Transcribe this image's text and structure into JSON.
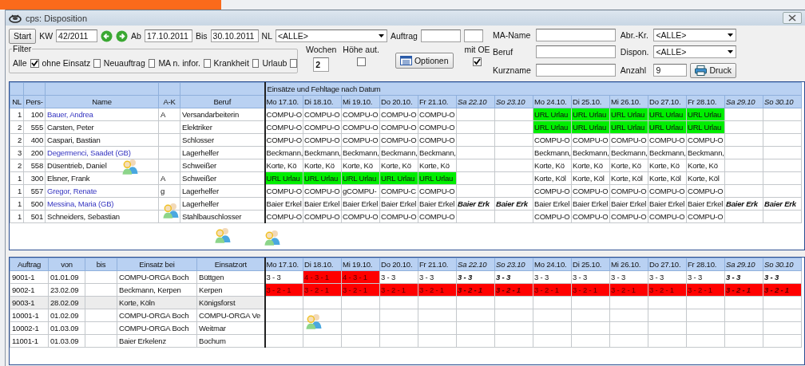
{
  "window": {
    "title": "cps: Disposition"
  },
  "toolbar": {
    "start": "Start",
    "kw_label": "KW",
    "kw": "42/2011",
    "ab_label": "Ab",
    "ab": "17.10.2011",
    "bis_label": "Bis",
    "bis": "30.10.2011",
    "nl_label": "NL",
    "nl": "<ALLE>",
    "auftrag_label": "Auftrag",
    "wochen_label": "Wochen",
    "wochen": "2",
    "hoehe_label": "Höhe aut.",
    "hoehe_checked": false,
    "optionen": "Optionen",
    "mit_oe_label": "mit OE",
    "mit_oe_checked": true,
    "ma_name_label": "MA-Name",
    "abr_label": "Abr.-Kr.",
    "abr": "<ALLE>",
    "beruf_label": "Beruf",
    "dispon_label": "Dispon.",
    "dispon": "<ALLE>",
    "kurzname_label": "Kurzname",
    "anzahl_label": "Anzahl",
    "anzahl": "9",
    "druck": "Druck"
  },
  "filter": {
    "title": "Filter",
    "items": [
      {
        "label": "Alle",
        "checked": true
      },
      {
        "label": "ohne Einsatz",
        "checked": false
      },
      {
        "label": "Neuauftrag",
        "checked": false
      },
      {
        "label": "MA n. infor.",
        "checked": false
      },
      {
        "label": "Krankheit",
        "checked": false
      },
      {
        "label": "Urlaub",
        "checked": false
      }
    ]
  },
  "schedule": {
    "group_title": "Einsätze und Fehltage nach Datum",
    "columns": [
      "NL",
      "Pers-",
      "Name",
      "A-K",
      "Beruf"
    ],
    "days": [
      {
        "label": "Mo 17.10.",
        "weekend": false
      },
      {
        "label": "Di 18.10.",
        "weekend": false
      },
      {
        "label": "Mi 19.10.",
        "weekend": false
      },
      {
        "label": "Do 20.10.",
        "weekend": false
      },
      {
        "label": "Fr 21.10.",
        "weekend": false
      },
      {
        "label": "Sa 22.10",
        "weekend": true
      },
      {
        "label": "So 23.10",
        "weekend": true
      },
      {
        "label": "Mo 24.10.",
        "weekend": false
      },
      {
        "label": "Di 25.10.",
        "weekend": false
      },
      {
        "label": "Mi 26.10.",
        "weekend": false
      },
      {
        "label": "Do 27.10.",
        "weekend": false
      },
      {
        "label": "Fr 28.10.",
        "weekend": false
      },
      {
        "label": "Sa 29.10",
        "weekend": true
      },
      {
        "label": "So 30.10",
        "weekend": true
      }
    ],
    "rows": [
      {
        "nl": "1",
        "pers": "100",
        "name": "Bauer, Andrea",
        "linked": true,
        "ak": "A",
        "beruf": "Versandarbeiterin",
        "days": [
          {
            "kind": "text",
            "text": "COMPU-O"
          },
          {
            "kind": "text",
            "text": "COMPU-O"
          },
          {
            "kind": "text",
            "text": "COMPU-O"
          },
          {
            "kind": "text",
            "text": "COMPU-O"
          },
          {
            "kind": "text",
            "text": "COMPU-O"
          },
          {
            "kind": "blank"
          },
          {
            "kind": "blank"
          },
          {
            "kind": "text",
            "text": "URL Urlau",
            "color": "#00ee00"
          },
          {
            "kind": "text",
            "text": "URL Urlau",
            "color": "#00ee00"
          },
          {
            "kind": "text",
            "text": "URL Urlau",
            "color": "#00ee00"
          },
          {
            "kind": "text",
            "text": "URL Urlau",
            "color": "#00ee00"
          },
          {
            "kind": "text",
            "text": "URL Urlau",
            "color": "#00ee00"
          },
          {
            "kind": "blank"
          },
          {
            "kind": "blank"
          }
        ]
      },
      {
        "nl": "2",
        "pers": "555",
        "name": "Carsten, Peter",
        "linked": false,
        "beruf": "Elektriker",
        "days": [
          {
            "kind": "text",
            "text": "COMPU-O"
          },
          {
            "kind": "text",
            "text": "COMPU-O"
          },
          {
            "kind": "text",
            "text": "COMPU-O"
          },
          {
            "kind": "text",
            "text": "COMPU-O"
          },
          {
            "kind": "text",
            "text": "COMPU-O"
          },
          {
            "kind": "blank"
          },
          {
            "kind": "blank"
          },
          {
            "kind": "text",
            "text": "URL Urlau",
            "color": "#00ee00"
          },
          {
            "kind": "text",
            "text": "URL Urlau",
            "color": "#00ee00"
          },
          {
            "kind": "text",
            "text": "URL Urlau",
            "color": "#00ee00"
          },
          {
            "kind": "text",
            "text": "URL Urlau",
            "color": "#00ee00"
          },
          {
            "kind": "text",
            "text": "URL Urlau",
            "color": "#00ee00"
          },
          {
            "kind": "blank"
          },
          {
            "kind": "blank"
          }
        ]
      },
      {
        "nl": "2",
        "pers": "400",
        "name": "Caspari, Bastian",
        "linked": false,
        "beruf": "Schlosser",
        "days": [
          {
            "kind": "text",
            "text": "COMPU-O"
          },
          {
            "kind": "text",
            "text": "COMPU-O"
          },
          {
            "kind": "text",
            "text": "COMPU-O"
          },
          {
            "kind": "text",
            "text": "COMPU-O"
          },
          {
            "kind": "text",
            "text": "COMPU-O"
          },
          {
            "kind": "blank"
          },
          {
            "kind": "blank"
          },
          {
            "kind": "text",
            "text": "COMPU-O"
          },
          {
            "kind": "text",
            "text": "COMPU-O"
          },
          {
            "kind": "text",
            "text": "COMPU-O"
          },
          {
            "kind": "text",
            "text": "COMPU-O"
          },
          {
            "kind": "text",
            "text": "COMPU-O"
          },
          {
            "kind": "blank"
          },
          {
            "kind": "blank"
          }
        ]
      },
      {
        "nl": "3",
        "pers": "200",
        "name": "Degermenci, Saadet (GB)",
        "linked": true,
        "beruf": "Lagerhelfer",
        "days": [
          {
            "kind": "text",
            "text": "Beckmann,"
          },
          {
            "kind": "text",
            "text": "Beckmann,"
          },
          {
            "kind": "text",
            "text": "Beckmann,"
          },
          {
            "kind": "text",
            "text": "Beckmann,"
          },
          {
            "kind": "text",
            "text": "Beckmann,"
          },
          {
            "kind": "blank"
          },
          {
            "kind": "blank"
          },
          {
            "kind": "text",
            "text": "Beckmann,"
          },
          {
            "kind": "text",
            "text": "Beckmann,"
          },
          {
            "kind": "text",
            "text": "Beckmann,"
          },
          {
            "kind": "text",
            "text": "Beckmann,"
          },
          {
            "kind": "text",
            "text": "Beckmann,"
          },
          {
            "kind": "blank"
          },
          {
            "kind": "blank"
          }
        ]
      },
      {
        "nl": "2",
        "pers": "558",
        "name": "Düsentrieb, Daniel",
        "linked": false,
        "beruf": "Schweißer",
        "days": [
          {
            "kind": "text",
            "text": "Korte, Kö"
          },
          {
            "kind": "text",
            "text": "Korte, Kö"
          },
          {
            "kind": "text",
            "text": "Korte, Kö"
          },
          {
            "kind": "text",
            "text": "Korte, Kö"
          },
          {
            "kind": "text",
            "text": "Korte, Kö"
          },
          {
            "kind": "blank"
          },
          {
            "kind": "blank"
          },
          {
            "kind": "text",
            "text": "Korte, Kö"
          },
          {
            "kind": "text",
            "text": "Korte, Kö"
          },
          {
            "kind": "text",
            "text": "Korte, Kö"
          },
          {
            "kind": "text",
            "text": "Korte, Kö"
          },
          {
            "kind": "text",
            "text": "Korte, Kö"
          },
          {
            "kind": "blank"
          },
          {
            "kind": "blank"
          }
        ]
      },
      {
        "nl": "1",
        "pers": "300",
        "name": "Elsner, Frank",
        "linked": false,
        "ak": "A",
        "beruf": "Schweißer",
        "days": [
          {
            "kind": "text",
            "text": "URL Urlau",
            "color": "#00ee00"
          },
          {
            "kind": "text",
            "text": "URL Urlau",
            "color": "#00ee00"
          },
          {
            "kind": "text",
            "text": "URL Urlau",
            "color": "#00ee00"
          },
          {
            "kind": "text",
            "text": "URL Urlau",
            "color": "#00ee00"
          },
          {
            "kind": "text",
            "text": "URL Urlau",
            "color": "#00ee00"
          },
          {
            "kind": "blank"
          },
          {
            "kind": "blank"
          },
          {
            "kind": "text",
            "text": "Korte, Köl"
          },
          {
            "kind": "text",
            "text": "Korte, Köl"
          },
          {
            "kind": "text",
            "text": "Korte, Köl"
          },
          {
            "kind": "text",
            "text": "Korte, Köl"
          },
          {
            "kind": "text",
            "text": "Korte, Köl"
          },
          {
            "kind": "blank"
          },
          {
            "kind": "blank"
          }
        ]
      },
      {
        "nl": "1",
        "pers": "557",
        "name": "Gregor, Renate",
        "linked": true,
        "ak": "g",
        "beruf": "Lagerhelfer",
        "days": [
          {
            "kind": "text",
            "text": "COMPU-O"
          },
          {
            "kind": "text",
            "text": "COMPU-O"
          },
          {
            "kind": "text",
            "text": "gCOMPU-"
          },
          {
            "kind": "text",
            "text": "COMPU-C"
          },
          {
            "kind": "text",
            "text": "COMPU-O"
          },
          {
            "kind": "blank"
          },
          {
            "kind": "blank"
          },
          {
            "kind": "text",
            "text": "COMPU-O"
          },
          {
            "kind": "text",
            "text": "COMPU-O"
          },
          {
            "kind": "text",
            "text": "COMPU-O"
          },
          {
            "kind": "text",
            "text": "COMPU-O"
          },
          {
            "kind": "text",
            "text": "COMPU-O"
          },
          {
            "kind": "blank"
          },
          {
            "kind": "blank"
          }
        ]
      },
      {
        "nl": "1",
        "pers": "500",
        "name": "Messina, Maria (GB)",
        "linked": true,
        "beruf": "Lagerhelfer",
        "days": [
          {
            "kind": "text",
            "text": "Baier Erkel"
          },
          {
            "kind": "text",
            "text": "Baier Erkel"
          },
          {
            "kind": "text",
            "text": "Baier Erkel"
          },
          {
            "kind": "text",
            "text": "Baier Erkel"
          },
          {
            "kind": "text",
            "text": "Baier Erkel"
          },
          {
            "kind": "text",
            "text": "Baier Erk"
          },
          {
            "kind": "text",
            "text": "Baier Erk"
          },
          {
            "kind": "text",
            "text": "Baier Erkel"
          },
          {
            "kind": "text",
            "text": "Baier Erkel"
          },
          {
            "kind": "text",
            "text": "Baier Erkel"
          },
          {
            "kind": "text",
            "text": "Baier Erkel"
          },
          {
            "kind": "text",
            "text": "Baier Erkel"
          },
          {
            "kind": "text",
            "text": "Baier Erk"
          },
          {
            "kind": "text",
            "text": "Baier Erk"
          }
        ]
      },
      {
        "nl": "1",
        "pers": "501",
        "name": "Schneiders, Sebastian",
        "linked": false,
        "beruf": "Stahlbauschlosser",
        "days": [
          {
            "kind": "text",
            "text": "COMPU-O"
          },
          {
            "kind": "text",
            "text": "COMPU-O"
          },
          {
            "kind": "text",
            "text": "COMPU-O"
          },
          {
            "kind": "text",
            "text": "COMPU-O"
          },
          {
            "kind": "text",
            "text": "COMPU-O"
          },
          {
            "kind": "blank"
          },
          {
            "kind": "blank"
          },
          {
            "kind": "text",
            "text": "COMPU-O"
          },
          {
            "kind": "text",
            "text": "COMPU-O"
          },
          {
            "kind": "text",
            "text": "COMPU-O"
          },
          {
            "kind": "text",
            "text": "COMPU-O"
          },
          {
            "kind": "text",
            "text": "COMPU-O"
          },
          {
            "kind": "blank"
          },
          {
            "kind": "blank"
          }
        ]
      }
    ]
  },
  "orders": {
    "columns": [
      "Auftrag",
      "von",
      "bis",
      "Einsatz bei",
      "Einsatzort"
    ],
    "days": [
      {
        "label": "Mo 17.10.",
        "weekend": false
      },
      {
        "label": "Di 18.10.",
        "weekend": false
      },
      {
        "label": "Mi 19.10.",
        "weekend": false
      },
      {
        "label": "Do 20.10.",
        "weekend": false
      },
      {
        "label": "Fr 21.10.",
        "weekend": false
      },
      {
        "label": "Sa 22.10",
        "weekend": true
      },
      {
        "label": "So 23.10",
        "weekend": true
      },
      {
        "label": "Mo 24.10.",
        "weekend": false
      },
      {
        "label": "Di 25.10.",
        "weekend": false
      },
      {
        "label": "Mi 26.10.",
        "weekend": false
      },
      {
        "label": "Do 27.10.",
        "weekend": false
      },
      {
        "label": "Fr 28.10.",
        "weekend": false
      },
      {
        "label": "Sa 29.10",
        "weekend": true
      },
      {
        "label": "So 30.10",
        "weekend": true
      }
    ],
    "rows": [
      {
        "auftrag": "9001-1",
        "von": "01.01.09",
        "einsatz_bei": "COMPU-ORGA Boch",
        "einsatzort": "Büttgen",
        "selected": false,
        "days": [
          {
            "kind": "text",
            "text": "3 - 3"
          },
          {
            "kind": "text",
            "text": "4 - 3 - 1",
            "color": "#ff0000"
          },
          {
            "kind": "text",
            "text": "4 - 3 - 1",
            "color": "#ff0000"
          },
          {
            "kind": "text",
            "text": "3 - 3"
          },
          {
            "kind": "text",
            "text": "3 - 3"
          },
          {
            "kind": "text",
            "text": "3 - 3"
          },
          {
            "kind": "text",
            "text": "3 - 3"
          },
          {
            "kind": "text",
            "text": "3 - 3"
          },
          {
            "kind": "text",
            "text": "3 - 3"
          },
          {
            "kind": "text",
            "text": "3 - 3"
          },
          {
            "kind": "text",
            "text": "3 - 3"
          },
          {
            "kind": "text",
            "text": "3 - 3"
          },
          {
            "kind": "text",
            "text": "3 - 3"
          },
          {
            "kind": "text",
            "text": "3 - 3"
          }
        ]
      },
      {
        "auftrag": "9002-1",
        "von": "23.02.09",
        "einsatz_bei": "Beckmann, Kerpen",
        "einsatzort": "Kerpen",
        "selected": false,
        "days": [
          {
            "kind": "text",
            "text": "3 - 2 - 1",
            "color": "#ff0000"
          },
          {
            "kind": "text",
            "text": "3 - 2 - 1",
            "color": "#ff0000"
          },
          {
            "kind": "text",
            "text": "3 - 2 - 1",
            "color": "#ff0000"
          },
          {
            "kind": "text",
            "text": "3 - 2 - 1",
            "color": "#ff0000"
          },
          {
            "kind": "text",
            "text": "3 - 2 - 1",
            "color": "#ff0000"
          },
          {
            "kind": "text",
            "text": "3 - 2 - 1",
            "color": "#ff0000"
          },
          {
            "kind": "text",
            "text": "3 - 2 - 1",
            "color": "#ff0000"
          },
          {
            "kind": "text",
            "text": "3 - 2 - 1",
            "color": "#ff0000"
          },
          {
            "kind": "text",
            "text": "3 - 2 - 1",
            "color": "#ff0000"
          },
          {
            "kind": "text",
            "text": "3 - 2 - 1",
            "color": "#ff0000"
          },
          {
            "kind": "text",
            "text": "3 - 2 - 1",
            "color": "#ff0000"
          },
          {
            "kind": "text",
            "text": "3 - 2 - 1",
            "color": "#ff0000"
          },
          {
            "kind": "text",
            "text": "3 - 2 - 1",
            "color": "#ff0000"
          },
          {
            "kind": "text",
            "text": "3 - 2 - 1",
            "color": "#ff0000"
          }
        ]
      },
      {
        "auftrag": "9003-1",
        "von": "28.02.09",
        "einsatz_bei": "Korte, Köln",
        "einsatzort": "Königsforst",
        "selected": true
      },
      {
        "auftrag": "10001-1",
        "von": "01.02.09",
        "einsatz_bei": "COMPU-ORGA Boch",
        "einsatzort": "COMPU-ORGA Ve",
        "selected": false
      },
      {
        "auftrag": "10002-1",
        "von": "01.03.09",
        "einsatz_bei": "COMPU-ORGA Boch",
        "einsatzort": "Weitmar",
        "selected": false
      },
      {
        "auftrag": "11001-1",
        "von": "01.03.09",
        "einsatz_bei": "Baier Erkelenz",
        "einsatzort": "Bochum",
        "selected": false
      }
    ]
  }
}
